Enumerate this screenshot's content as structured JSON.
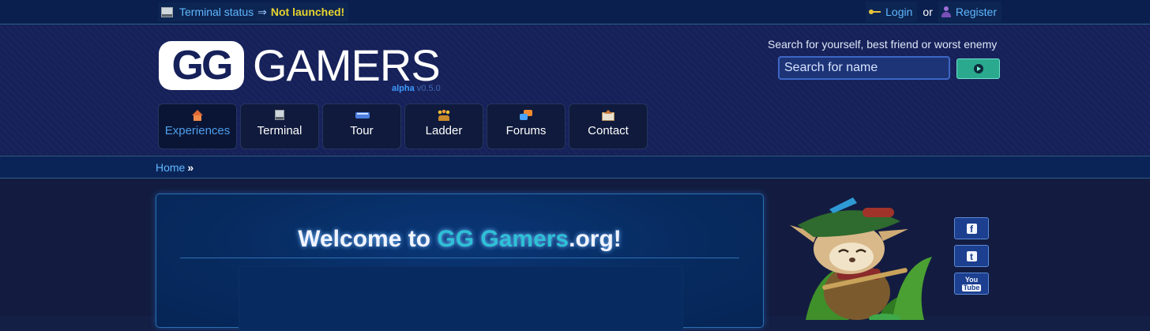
{
  "topbar": {
    "status_label": "Terminal status",
    "status_arrow": "⇒",
    "status_value": "Not launched!",
    "login": "Login",
    "or": "or",
    "register": "Register"
  },
  "header": {
    "logo_gg": "GG",
    "logo_gamers": "GAMERS",
    "logo_alpha": "alpha",
    "logo_version": "v0.5.0",
    "search_caption": "Search for yourself, best friend or worst enemy",
    "search_placeholder": "Search for name"
  },
  "nav": [
    {
      "label": "Experiences",
      "icon": "home-icon",
      "active": true
    },
    {
      "label": "Terminal",
      "icon": "terminal-icon",
      "active": false
    },
    {
      "label": "Tour",
      "icon": "bus-icon",
      "active": false
    },
    {
      "label": "Ladder",
      "icon": "people-icon",
      "active": false
    },
    {
      "label": "Forums",
      "icon": "chat-icon",
      "active": false
    },
    {
      "label": "Contact",
      "icon": "mail-icon",
      "active": false
    }
  ],
  "breadcrumb": {
    "home": "Home",
    "separator": "»"
  },
  "main": {
    "welcome_prefix": "Welcome to ",
    "welcome_highlight": "GG Gamers",
    "welcome_suffix": ".org!"
  },
  "social": {
    "facebook": "f",
    "twitter": "t",
    "youtube_top": "You",
    "youtube_bottom": "Tube"
  },
  "colors": {
    "accent_link": "#5fb8ff",
    "status_warning": "#e7d32f",
    "highlight": "#2ec0d6",
    "search_button": "#2aa98f"
  }
}
